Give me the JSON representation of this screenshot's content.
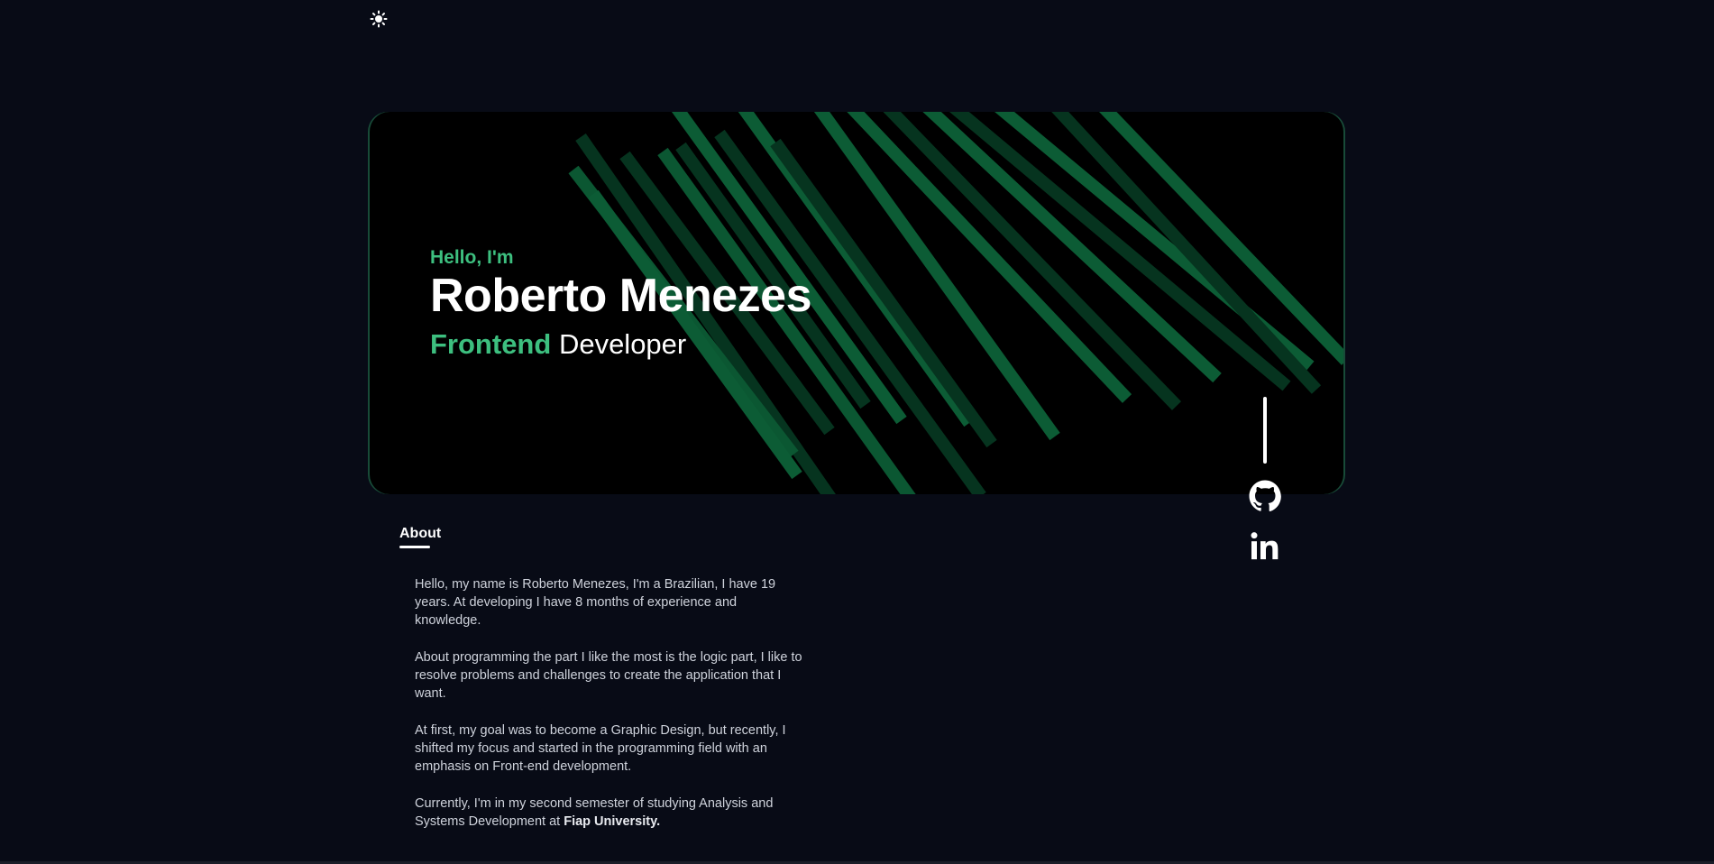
{
  "colors": {
    "background": "#080b16",
    "hero_bg": "#000000",
    "accent": "#3dbf7f",
    "stripe_bright": "#0c5c35",
    "stripe_dark": "#06341f",
    "text": "#ffffff"
  },
  "theme_toggle": {
    "icon": "sun-icon"
  },
  "hero": {
    "greeting": "Hello, I'm",
    "name": "Roberto Menezes",
    "role_accent": "Frontend",
    "role_rest": "Developer"
  },
  "social": {
    "github_icon": "github-icon",
    "linkedin_icon": "linkedin-icon"
  },
  "tabs": {
    "about_label": "About"
  },
  "about": {
    "paragraph1": "Hello, my name is Roberto Menezes, I'm a Brazilian, I have 19 years. At developing I have 8 months of experience and knowledge.",
    "paragraph2": "About programming the part I like the most is the logic part, I like to resolve problems and challenges to create the application that I want.",
    "paragraph3": "At first, my goal was to become a Graphic Design, but recently, I shifted my focus and started in the programming field with an emphasis on Front-end development.",
    "paragraph4_text": "Currently, I'm in my second semester of studying Analysis and Systems Development at ",
    "paragraph4_strong": "Fiap University."
  }
}
